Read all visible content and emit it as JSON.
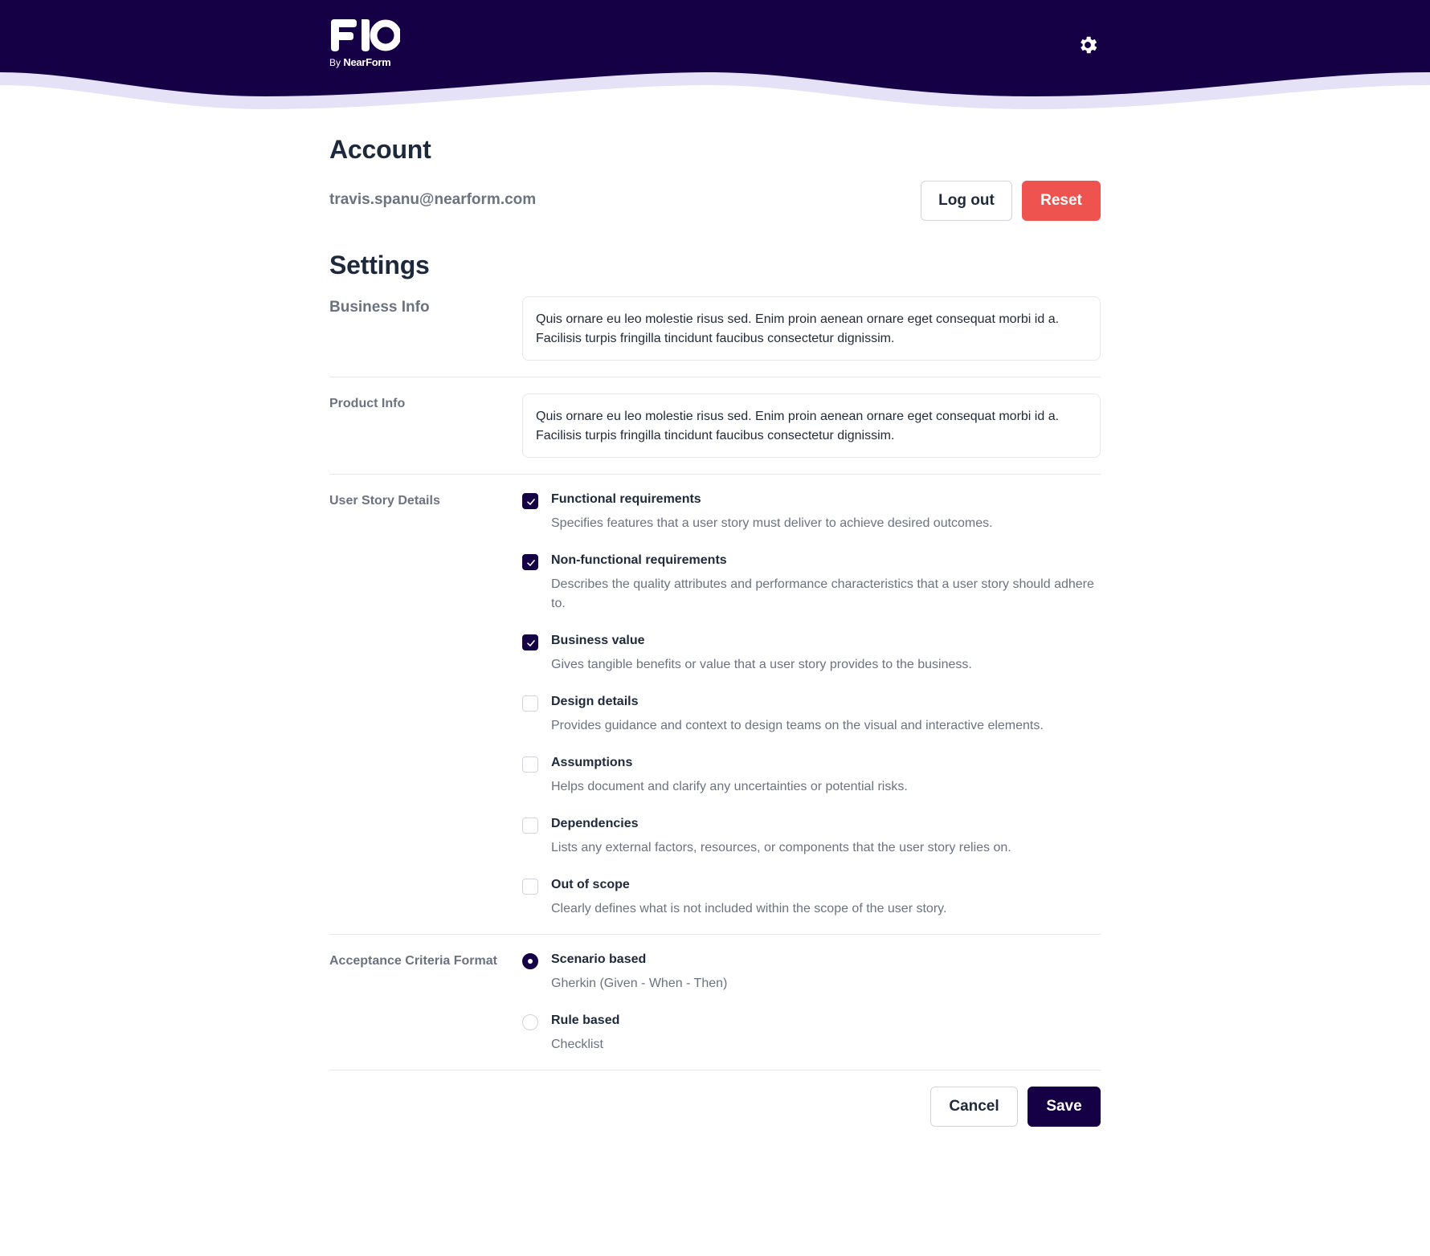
{
  "header": {
    "logo_text": "FIO",
    "logo_by": "By",
    "logo_brand": "NearForm",
    "settings_icon": "gear-icon",
    "colors": {
      "navy": "#150046",
      "lavender": "#e5e1f6"
    }
  },
  "account": {
    "title": "Account",
    "email": "travis.spanu@nearform.com",
    "logout_label": "Log out",
    "reset_label": "Reset",
    "reset_color": "#ef5350"
  },
  "settings": {
    "title": "Settings",
    "business_info": {
      "label": "Business Info",
      "value": "Quis ornare eu leo molestie risus sed. Enim proin aenean ornare eget consequat morbi id a. Facilisis turpis fringilla tincidunt faucibus consectetur dignissim."
    },
    "product_info": {
      "label": "Product Info",
      "value": "Quis ornare eu leo molestie risus sed. Enim proin aenean ornare eget consequat morbi id a. Facilisis turpis fringilla tincidunt faucibus consectetur dignissim."
    },
    "user_story_details": {
      "label": "User Story Details",
      "options": [
        {
          "title": "Functional requirements",
          "description": "Specifies features that a user story must deliver to achieve desired outcomes.",
          "checked": true
        },
        {
          "title": "Non-functional requirements",
          "description": "Describes the quality attributes and performance characteristics that a user story should adhere to.",
          "checked": true
        },
        {
          "title": "Business value",
          "description": "Gives tangible benefits or value that a user story provides to the business.",
          "checked": true
        },
        {
          "title": "Design details",
          "description": "Provides guidance and context to design teams on the visual and interactive elements.",
          "checked": false
        },
        {
          "title": "Assumptions",
          "description": "Helps document and clarify any uncertainties or potential risks.",
          "checked": false
        },
        {
          "title": "Dependencies",
          "description": "Lists any external factors, resources, or components that the user story relies on.",
          "checked": false
        },
        {
          "title": "Out of scope",
          "description": "Clearly defines what is not included within the scope of the user story.",
          "checked": false
        }
      ]
    },
    "acceptance_criteria_format": {
      "label": "Acceptance Criteria Format",
      "options": [
        {
          "title": "Scenario based",
          "description": "Gherkin (Given - When - Then)",
          "selected": true
        },
        {
          "title": "Rule based",
          "description": "Checklist",
          "selected": false
        }
      ]
    }
  },
  "footer": {
    "cancel_label": "Cancel",
    "save_label": "Save"
  }
}
